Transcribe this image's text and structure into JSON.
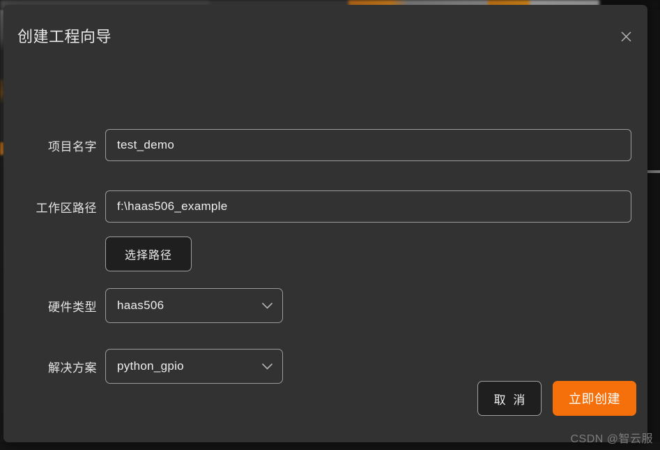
{
  "dialog": {
    "title": "创建工程向导",
    "close_icon": "close-icon"
  },
  "form": {
    "fields": [
      {
        "label": "项目名字",
        "type": "text",
        "value": "test_demo",
        "placeholder": ""
      },
      {
        "label": "工作区路径",
        "type": "text",
        "value": "f:\\haas506_example",
        "placeholder": ""
      },
      {
        "label": "硬件类型",
        "type": "select",
        "value": "haas506",
        "chevron_icon": "chevron-down-icon"
      },
      {
        "label": "解决方案",
        "type": "select",
        "value": "python_gpio",
        "chevron_icon": "chevron-down-icon"
      }
    ],
    "browse_button": "选择路径"
  },
  "footer": {
    "cancel_label": "取 消",
    "create_label": "立即创建"
  },
  "watermark": "CSDN @智云服",
  "colors": {
    "accent_orange": "#f5700a",
    "dialog_bg": "#323232",
    "border": "#9b9b9b",
    "text": "#e8e8e8",
    "button_dark": "#1f1f1f"
  }
}
